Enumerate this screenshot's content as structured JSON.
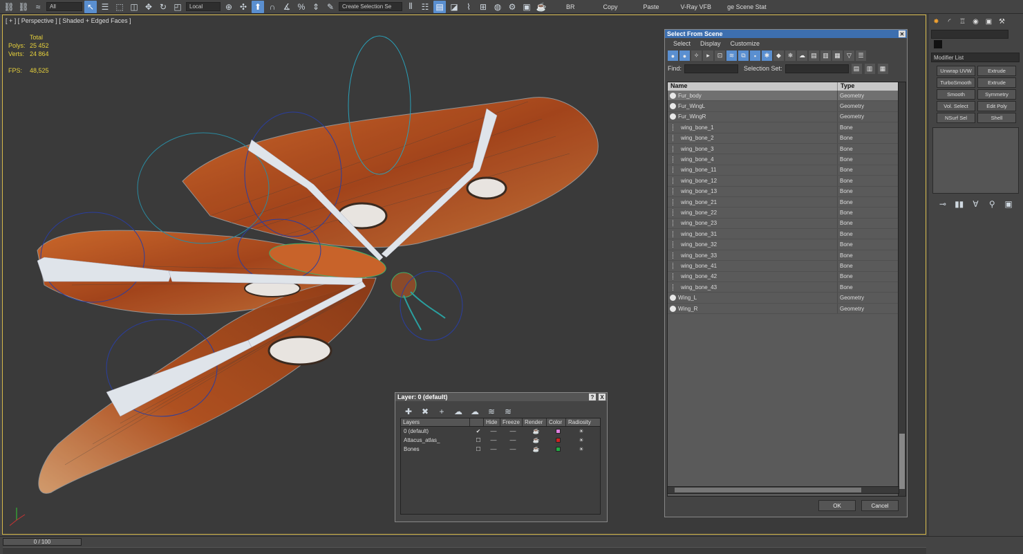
{
  "toolbar": {
    "filter": "All",
    "coord_system": "Local",
    "selection_set": "Create Selection Se",
    "buttons": [
      "BR",
      "Copy",
      "Paste",
      "V-Ray VFB",
      "ge Scene Stat"
    ]
  },
  "viewport": {
    "label": "[ + ] [ Perspective ] [ Shaded + Edged Faces ]",
    "stats": {
      "total_header": "Total",
      "polys_label": "Polys:",
      "polys_value": "25 452",
      "verts_label": "Verts:",
      "verts_value": "24 864",
      "fps_label": "FPS:",
      "fps_value": "48,525"
    }
  },
  "select_dialog": {
    "title": "Select From Scene",
    "menu": [
      "Select",
      "Display",
      "Customize"
    ],
    "find_label": "Find:",
    "selection_set_label": "Selection Set:",
    "col_name": "Name",
    "col_type": "Type",
    "items": [
      {
        "name": "Fur_body",
        "type": "Geometry",
        "kind": "geo",
        "selected": true
      },
      {
        "name": "Fur_WingL",
        "type": "Geometry",
        "kind": "geo",
        "selected": false
      },
      {
        "name": "Fur_WingR",
        "type": "Geometry",
        "kind": "geo",
        "selected": false
      },
      {
        "name": "wing_bone_1",
        "type": "Bone",
        "kind": "bone",
        "selected": false
      },
      {
        "name": "wing_bone_2",
        "type": "Bone",
        "kind": "bone",
        "selected": false
      },
      {
        "name": "wing_bone_3",
        "type": "Bone",
        "kind": "bone",
        "selected": false
      },
      {
        "name": "wing_bone_4",
        "type": "Bone",
        "kind": "bone",
        "selected": false
      },
      {
        "name": "wing_bone_11",
        "type": "Bone",
        "kind": "bone",
        "selected": false
      },
      {
        "name": "wing_bone_12",
        "type": "Bone",
        "kind": "bone",
        "selected": false
      },
      {
        "name": "wing_bone_13",
        "type": "Bone",
        "kind": "bone",
        "selected": false
      },
      {
        "name": "wing_bone_21",
        "type": "Bone",
        "kind": "bone",
        "selected": false
      },
      {
        "name": "wing_bone_22",
        "type": "Bone",
        "kind": "bone",
        "selected": false
      },
      {
        "name": "wing_bone_23",
        "type": "Bone",
        "kind": "bone",
        "selected": false
      },
      {
        "name": "wing_bone_31",
        "type": "Bone",
        "kind": "bone",
        "selected": false
      },
      {
        "name": "wing_bone_32",
        "type": "Bone",
        "kind": "bone",
        "selected": false
      },
      {
        "name": "wing_bone_33",
        "type": "Bone",
        "kind": "bone",
        "selected": false
      },
      {
        "name": "wing_bone_41",
        "type": "Bone",
        "kind": "bone",
        "selected": false
      },
      {
        "name": "wing_bone_42",
        "type": "Bone",
        "kind": "bone",
        "selected": false
      },
      {
        "name": "wing_bone_43",
        "type": "Bone",
        "kind": "bone",
        "selected": false
      },
      {
        "name": "Wing_L",
        "type": "Geometry",
        "kind": "geo",
        "selected": false
      },
      {
        "name": "Wing_R",
        "type": "Geometry",
        "kind": "geo",
        "selected": false
      }
    ],
    "ok": "OK",
    "cancel": "Cancel"
  },
  "layer_dialog": {
    "title": "Layer: 0 (default)",
    "help": "?",
    "close": "X",
    "columns": [
      "Layers",
      "Hide",
      "Freeze",
      "Render",
      "Color",
      "Radiosity"
    ],
    "layers": [
      {
        "name": "0 (default)",
        "color": "#e080e0",
        "current": true
      },
      {
        "name": "Attacus_atlas_",
        "color": "#cc2222",
        "current": false
      },
      {
        "name": "Bones",
        "color": "#22aa44",
        "current": false
      }
    ]
  },
  "command_panel": {
    "modifier_list": "Modifier List",
    "modifiers": [
      "Unwrap UVW",
      "Extrude",
      "TurboSmooth",
      "Extrude",
      "Smooth",
      "Symmetry",
      "Vol. Select",
      "Edit Poly",
      "NSurf Sel",
      "Shell"
    ]
  },
  "timeline": {
    "frame": "0 / 100"
  },
  "colors": {
    "viewport_border": "#d6b94a",
    "stats_text": "#e8d23c",
    "title_bar": "#3d6faf",
    "wing_orange": "#b8541e",
    "bone_white": "#dfe4ea"
  }
}
